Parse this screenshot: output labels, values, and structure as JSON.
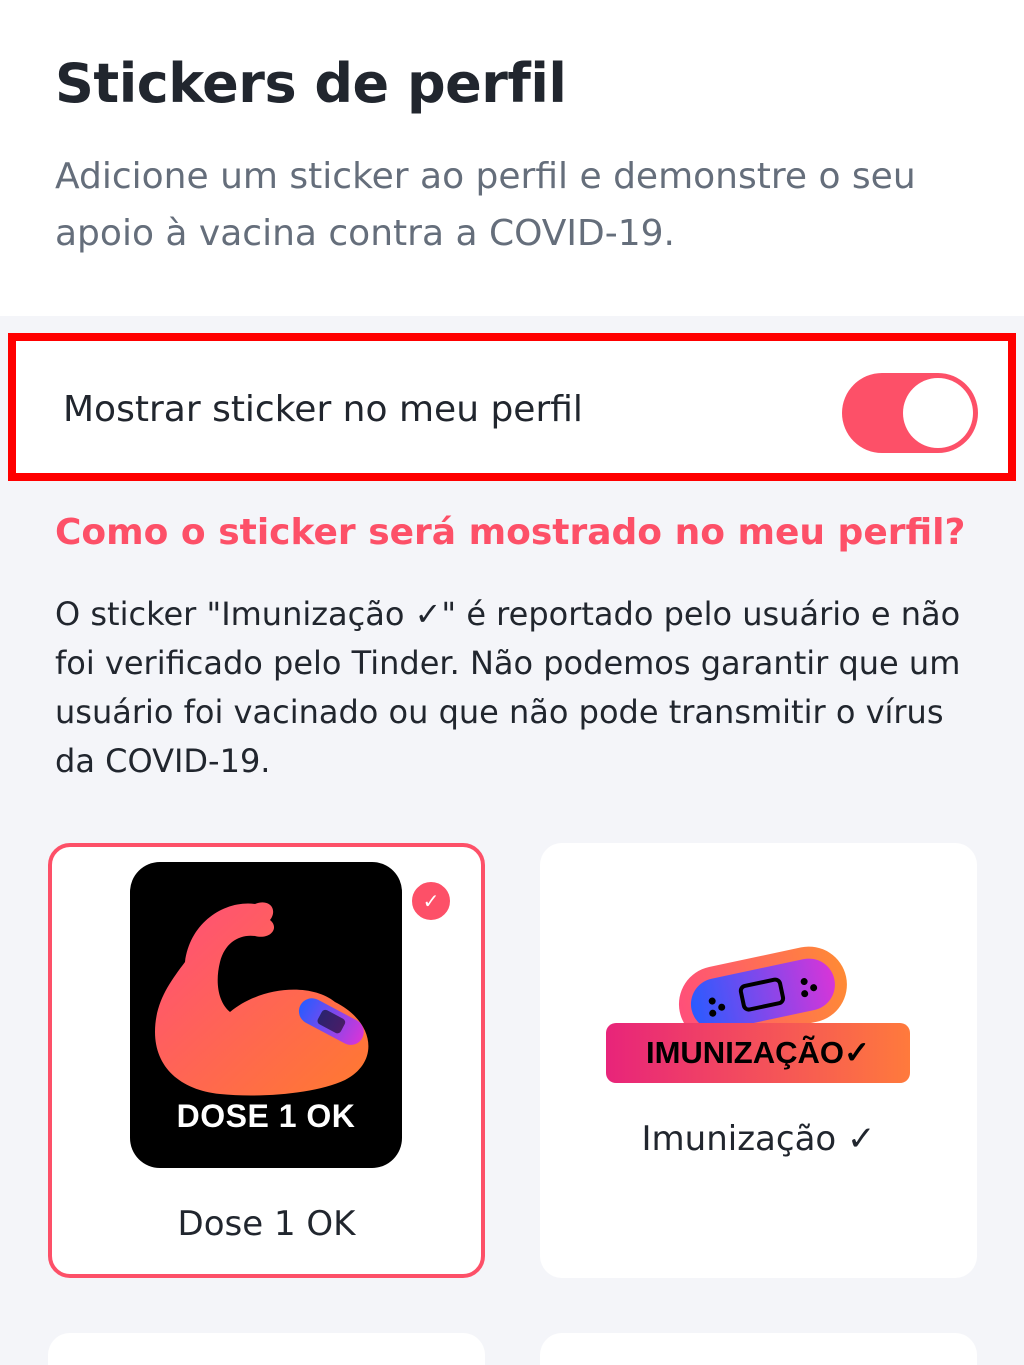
{
  "header": {
    "title": "Stickers de perfil",
    "subtitle": "Adicione um sticker ao perfil e demonstre o seu apoio à vacina contra a COVID-19."
  },
  "toggle_row": {
    "label": "Mostrar sticker no meu perfil",
    "enabled": true,
    "accent": "#fd5068",
    "highlight": "#ff0000"
  },
  "info": {
    "question": "Como o sticker será mostrado no meu perfil?",
    "body": "O sticker \"Imunização ✓\" é reportado pelo usuário e não foi verificado pelo Tinder. Não podemos garantir que um usuário foi vacinado ou que não pode transmitir o vírus da COVID-19."
  },
  "stickers": [
    {
      "label": "Dose 1 OK",
      "art_text": "DOSE 1 OK",
      "selected": true,
      "icon": "flexed-arm-bandage-icon"
    },
    {
      "label": "Imunização ✓",
      "art_text": "IMUNIZAÇÃO✓",
      "selected": false,
      "icon": "bandage-icon"
    }
  ],
  "colors": {
    "accent": "#fd5068",
    "text": "#21262e",
    "muted": "#656e7b",
    "background": "#f4f5f9"
  }
}
